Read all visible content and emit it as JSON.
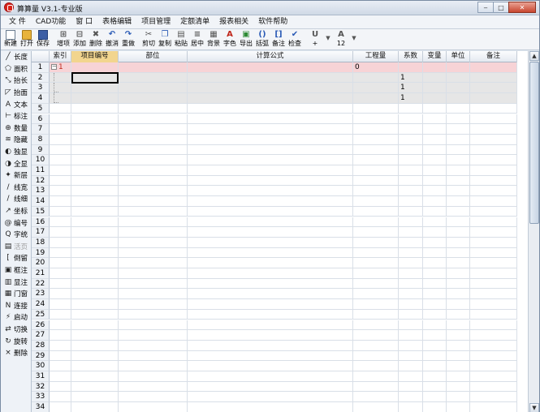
{
  "window": {
    "title": "算算量 V3.1-专业版",
    "controls": [
      "‒",
      "□",
      "✕"
    ]
  },
  "menu": [
    "文 件",
    "CAD功能",
    "窗 口",
    "表格编辑",
    "项目管理",
    "定额清单",
    "报表相关",
    "软件帮助"
  ],
  "toolbar": [
    {
      "label": "新建",
      "icon": "new-doc-icon"
    },
    {
      "label": "打开",
      "icon": "open-folder-icon"
    },
    {
      "label": "保存",
      "icon": "save-disk-icon"
    },
    {
      "label": "增项",
      "icon": "add-item-icon"
    },
    {
      "label": "添加",
      "icon": "insert-icon"
    },
    {
      "label": "删除",
      "icon": "delete-icon"
    },
    {
      "label": "撤消",
      "icon": "undo-icon"
    },
    {
      "label": "重做",
      "icon": "redo-icon"
    },
    {
      "label": "剪切",
      "icon": "cut-icon"
    },
    {
      "label": "复制",
      "icon": "copy-icon"
    },
    {
      "label": "粘贴",
      "icon": "paste-icon"
    },
    {
      "label": "居中",
      "icon": "align-center-icon"
    },
    {
      "label": "背景",
      "icon": "background-fill-icon"
    },
    {
      "label": "字色",
      "icon": "font-color-icon"
    },
    {
      "label": "导出",
      "icon": "export-icon"
    },
    {
      "label": "括弧",
      "icon": "parentheses-icon"
    },
    {
      "label": "备注",
      "icon": "brackets-icon"
    },
    {
      "label": "检查",
      "icon": "check-icon"
    },
    {
      "label": "+",
      "icon": "underline-icon"
    },
    {
      "label": "12",
      "icon": "font-size-icon"
    }
  ],
  "sidebar": [
    {
      "label": "长度",
      "icon": "line-length-icon",
      "disabled": false
    },
    {
      "label": "面积",
      "icon": "pentagon-area-icon",
      "disabled": false
    },
    {
      "label": "抬长",
      "icon": "pick-length-icon",
      "disabled": false
    },
    {
      "label": "抬面",
      "icon": "pick-area-icon",
      "disabled": false
    },
    {
      "label": "文本",
      "icon": "text-a-icon",
      "disabled": false
    },
    {
      "label": "标注",
      "icon": "dimension-icon",
      "disabled": false
    },
    {
      "label": "数量",
      "icon": "count-icon",
      "disabled": false
    },
    {
      "label": "隐藏",
      "icon": "hide-layers-icon",
      "disabled": false
    },
    {
      "label": "独显",
      "icon": "isolate-icon",
      "disabled": false
    },
    {
      "label": "全显",
      "icon": "show-all-icon",
      "disabled": false
    },
    {
      "label": "新层",
      "icon": "new-layer-icon",
      "disabled": false
    },
    {
      "label": "线宽",
      "icon": "line-width-icon",
      "disabled": false
    },
    {
      "label": "线细",
      "icon": "thin-line-icon",
      "disabled": false
    },
    {
      "label": "坐标",
      "icon": "coordinate-icon",
      "disabled": false
    },
    {
      "label": "编号",
      "icon": "numbering-icon",
      "disabled": false
    },
    {
      "label": "字统",
      "icon": "text-stat-icon",
      "disabled": false
    },
    {
      "label": "活页",
      "icon": "loose-leaf-icon",
      "disabled": true
    },
    {
      "label": "倒留",
      "icon": "bracket-icon",
      "disabled": false
    },
    {
      "label": "框注",
      "icon": "frame-note-icon",
      "disabled": false
    },
    {
      "label": "显注",
      "icon": "show-note-icon",
      "disabled": false
    },
    {
      "label": "门窗",
      "icon": "door-window-icon",
      "disabled": false
    },
    {
      "label": "连接",
      "icon": "connect-icon",
      "disabled": false
    },
    {
      "label": "启动",
      "icon": "startup-icon",
      "disabled": false
    },
    {
      "label": "切换",
      "icon": "switch-icon",
      "disabled": false
    },
    {
      "label": "旋转",
      "icon": "rotate-icon",
      "disabled": false
    },
    {
      "label": "删除",
      "icon": "close-x-icon",
      "disabled": false
    }
  ],
  "grid": {
    "columns": [
      "",
      "索引",
      "项目编号",
      "部位",
      "计算公式",
      "工程量",
      "系数",
      "变量",
      "单位",
      "备注"
    ],
    "selected_column": 2,
    "selected_row": 2,
    "rows": [
      {
        "index": "1",
        "code": "",
        "part": "",
        "formula": "",
        "qty": "0",
        "coef": "",
        "var": "",
        "unit": "",
        "note": "",
        "style": "pink"
      },
      {
        "index": "",
        "code": "",
        "part": "",
        "formula": "",
        "qty": "",
        "coef": "1",
        "var": "",
        "unit": "",
        "note": "",
        "style": "gray"
      },
      {
        "index": "",
        "code": "",
        "part": "",
        "formula": "",
        "qty": "",
        "coef": "1",
        "var": "",
        "unit": "",
        "note": "",
        "style": "gray"
      },
      {
        "index": "",
        "code": "",
        "part": "",
        "formula": "",
        "qty": "",
        "coef": "1",
        "var": "",
        "unit": "",
        "note": "",
        "style": "gray"
      }
    ],
    "row_numbers": [
      "1",
      "2",
      "3",
      "4",
      "5",
      "6",
      "7",
      "8",
      "9",
      "10",
      "11",
      "12",
      "13",
      "14",
      "15",
      "16",
      "17",
      "18",
      "19",
      "20",
      "21",
      "22",
      "23",
      "24",
      "25",
      "26",
      "27",
      "28",
      "29",
      "30",
      "31",
      "32",
      "33",
      "34"
    ]
  },
  "scrollbar": {
    "up": "▲",
    "down": "▼"
  }
}
